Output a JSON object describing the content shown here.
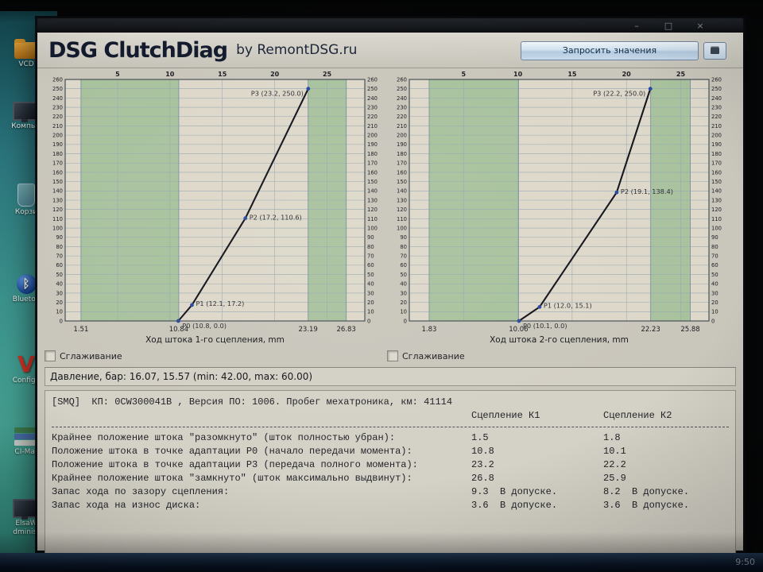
{
  "desktop": {
    "icons": [
      {
        "label": "VCD"
      },
      {
        "label": "Компью"
      },
      {
        "label": "Корзи"
      },
      {
        "label": "Bluetoo"
      },
      {
        "label": "Configu"
      },
      {
        "label": "CI-Mar"
      },
      {
        "label": "ElsaW",
        "label2": "dminist"
      }
    ],
    "taskbar_clock": "9:50"
  },
  "window": {
    "controls": {
      "minimize": "–",
      "maximize": "□",
      "close": "×"
    },
    "app_title": "DSG ClutchDiag",
    "app_subtitle": "by RemontDSG.ru",
    "request_button_label": "Запросить значения"
  },
  "smoothing": {
    "left_label": "Сглаживание",
    "right_label": "Сглаживание"
  },
  "pressure_line": "Давление, бар: 16.07, 15.57 (min: 42.00, max: 60.00)",
  "report": {
    "header_line": "[SMQ]  КП: 0CW300041B , Версия ПО: 1006. Пробег мехатроника, км: 41114",
    "col_k1": "Сцепление К1",
    "col_k2": "Сцепление К2",
    "rows": [
      {
        "label": "Крайнее положение штока \"разомкнуто\" (шток полностью убран):",
        "k1": "1.5",
        "k2": "1.8"
      },
      {
        "label": "Положение штока в точке адаптации P0 (начало передачи момента):",
        "k1": "10.8",
        "k2": "10.1"
      },
      {
        "label": "Положение штока в точке адаптации P3 (передача полного момента):",
        "k1": "23.2",
        "k2": "22.2"
      },
      {
        "label": "Крайнее положение штока \"замкнуто\" (шток максимально выдвинут):",
        "k1": "26.8",
        "k2": "25.9"
      },
      {
        "label": "Запас хода по зазору сцепления:",
        "k1": "9.3  В допуске.",
        "k2": "8.2  В допуске."
      },
      {
        "label": "Запас хода на износ диска:",
        "k1": "3.6  В допуске.",
        "k2": "3.6  В допуске."
      }
    ]
  },
  "chart_data": [
    {
      "type": "line",
      "title": "",
      "xlabel": "Ход штока 1-го сцепления, mm",
      "ylabel": "",
      "top_ticks": [
        5,
        10,
        15,
        20,
        25
      ],
      "xlim": [
        0,
        28.6
      ],
      "ylim": [
        0,
        260
      ],
      "y_tick_step": 10,
      "grid": true,
      "legend": "none",
      "zone_boundaries": [
        1.51,
        10.84,
        23.19,
        26.83
      ],
      "zone_labels": [
        "1.51",
        "10.84",
        "23.19",
        "26.83"
      ],
      "points": [
        {
          "name": "P0",
          "x": 10.8,
          "y": 0.0,
          "label": "P0 (10.8, 0.0)"
        },
        {
          "name": "P1",
          "x": 12.1,
          "y": 17.2,
          "label": "P1 (12.1, 17.2)"
        },
        {
          "name": "P2",
          "x": 17.2,
          "y": 110.6,
          "label": "P2 (17.2, 110.6)"
        },
        {
          "name": "P3",
          "x": 23.2,
          "y": 250.0,
          "label": "P3 (23.2, 250.0)"
        }
      ],
      "colors": {
        "band_green": "#a9c29e",
        "plot_bg": "#ddd8ca",
        "line": "#14141d",
        "marker": "#2a4a9e",
        "grid": "#97a9b2",
        "boundary": "#7a929c",
        "text": "#1c1c20"
      }
    },
    {
      "type": "line",
      "title": "",
      "xlabel": "Ход штока 2-го сцепления, mm",
      "ylabel": "",
      "top_ticks": [
        5,
        10,
        15,
        20,
        25
      ],
      "xlim": [
        0,
        27.6
      ],
      "ylim": [
        0,
        260
      ],
      "y_tick_step": 10,
      "grid": true,
      "legend": "none",
      "zone_boundaries": [
        1.83,
        10.06,
        22.23,
        25.88
      ],
      "zone_labels": [
        "1.83",
        "10.06",
        "22.23",
        "25.88"
      ],
      "points": [
        {
          "name": "P0",
          "x": 10.1,
          "y": 0.0,
          "label": "P0 (10.1, 0.0)"
        },
        {
          "name": "P1",
          "x": 12.0,
          "y": 15.1,
          "label": "P1 (12.0, 15.1)"
        },
        {
          "name": "P2",
          "x": 19.1,
          "y": 138.4,
          "label": "P2 (19.1, 138.4)"
        },
        {
          "name": "P3",
          "x": 22.2,
          "y": 250.0,
          "label": "P3 (22.2, 250.0)"
        }
      ],
      "colors": {
        "band_green": "#a9c29e",
        "plot_bg": "#ddd8ca",
        "line": "#14141d",
        "marker": "#2a4a9e",
        "grid": "#97a9b2",
        "boundary": "#7a929c",
        "text": "#1c1c20"
      }
    }
  ]
}
